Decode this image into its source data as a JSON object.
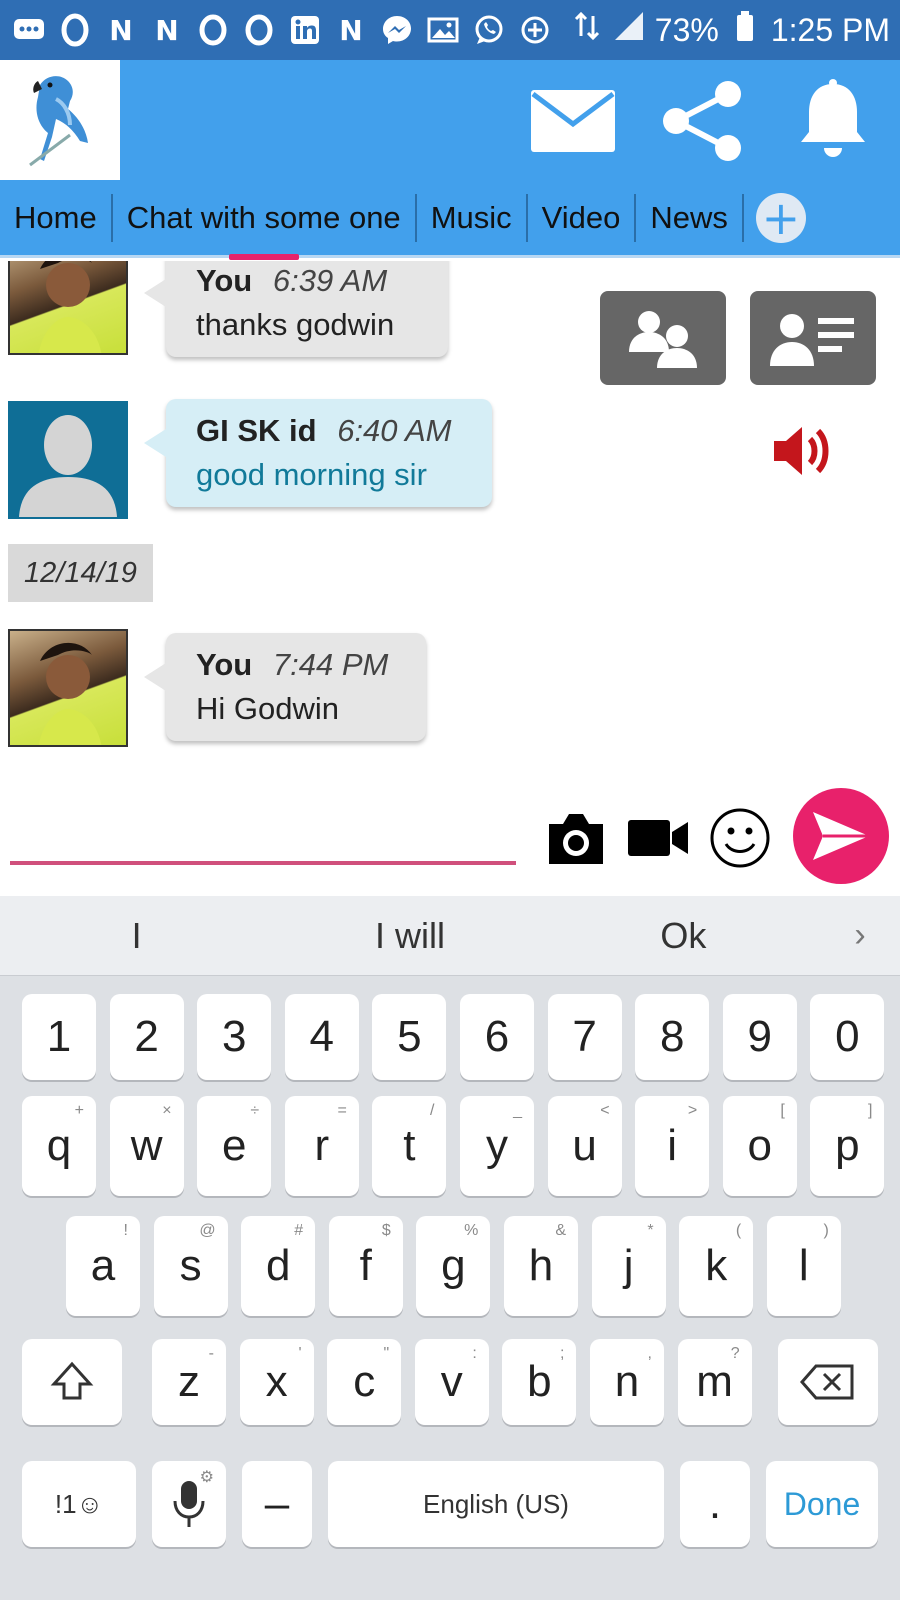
{
  "status_bar": {
    "notification_icons": [
      "messages-icon",
      "opera-icon",
      "n-icon",
      "n-icon",
      "opera-icon",
      "opera-icon",
      "linkedin-icon",
      "n-icon",
      "messenger-icon",
      "gallery-icon",
      "whatsapp-icon",
      "sync-icon"
    ],
    "battery": "73%",
    "time": "1:25 PM"
  },
  "header": {
    "logo_icon": "parrot-logo",
    "actions": [
      "mail-icon",
      "share-icon",
      "bell-icon"
    ]
  },
  "tabs": [
    {
      "label": "Home"
    },
    {
      "label": "Chat with some one",
      "active": true
    },
    {
      "label": "Music"
    },
    {
      "label": "Video"
    },
    {
      "label": "News"
    }
  ],
  "chat": {
    "messages": [
      {
        "sender": "You",
        "time": "6:39 AM",
        "text": "thanks godwin",
        "style": "grey",
        "avatar": "girl-photo"
      },
      {
        "sender": "GI SK id",
        "time": "6:40 AM",
        "text": "good morning sir",
        "style": "blue",
        "avatar": "default-avatar"
      },
      {
        "sender": "You",
        "time": "7:44 PM",
        "text": "Hi Godwin",
        "style": "grey",
        "avatar": "girl-photo"
      }
    ],
    "date_separator": "12/14/19"
  },
  "composer": {
    "placeholder": "",
    "value": ""
  },
  "keyboard": {
    "suggestions": [
      "I",
      "I will",
      "Ok"
    ],
    "number_row": [
      "1",
      "2",
      "3",
      "4",
      "5",
      "6",
      "7",
      "8",
      "9",
      "0"
    ],
    "row1": [
      {
        "k": "q",
        "s": "+"
      },
      {
        "k": "w",
        "s": "×"
      },
      {
        "k": "e",
        "s": "÷"
      },
      {
        "k": "r",
        "s": "="
      },
      {
        "k": "t",
        "s": "/"
      },
      {
        "k": "y",
        "s": "_"
      },
      {
        "k": "u",
        "s": "<"
      },
      {
        "k": "i",
        "s": ">"
      },
      {
        "k": "o",
        "s": "["
      },
      {
        "k": "p",
        "s": "]"
      }
    ],
    "row2": [
      {
        "k": "a",
        "s": "!"
      },
      {
        "k": "s",
        "s": "@"
      },
      {
        "k": "d",
        "s": "#"
      },
      {
        "k": "f",
        "s": "$"
      },
      {
        "k": "g",
        "s": "%"
      },
      {
        "k": "h",
        "s": "&"
      },
      {
        "k": "j",
        "s": "*"
      },
      {
        "k": "k",
        "s": "("
      },
      {
        "k": "l",
        "s": ")"
      }
    ],
    "row3": [
      {
        "k": "z",
        "s": "-"
      },
      {
        "k": "x",
        "s": "'"
      },
      {
        "k": "c",
        "s": "\""
      },
      {
        "k": "v",
        "s": ":"
      },
      {
        "k": "b",
        "s": ";"
      },
      {
        "k": "n",
        "s": ","
      },
      {
        "k": "m",
        "s": "?"
      }
    ],
    "symbols_label": "!1☺",
    "dash_label": "–",
    "space_label": "English (US)",
    "period_label": ".",
    "done_label": "Done"
  },
  "colors": {
    "status_bar": "#2f6eb4",
    "header": "#42a0ec",
    "accent": "#e8216b",
    "incoming_bubble": "#d6eef6",
    "outgoing_bubble": "#e6e6e6"
  }
}
